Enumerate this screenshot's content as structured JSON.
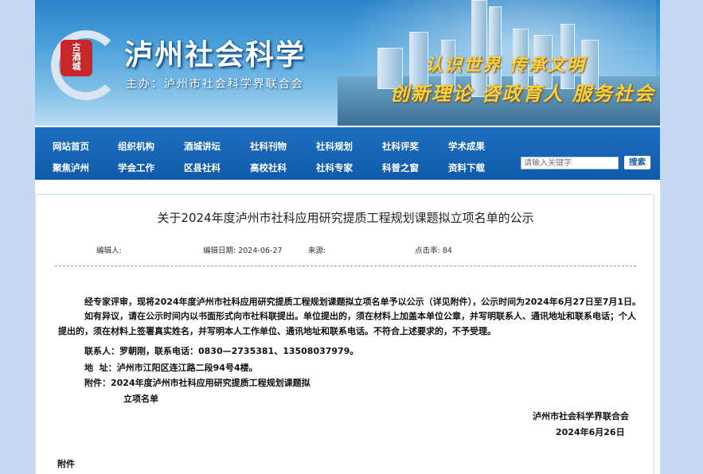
{
  "banner": {
    "title": "泸州社会科学",
    "subtitle": "主办：泸州市社会科学界联合会",
    "seal_text": "古\n酒\n城",
    "slogan_line1": "认识世界 传承文明",
    "slogan_line2": "创新理论 咨政育人 服务社会"
  },
  "nav": {
    "row1": [
      "网站首页",
      "组织机构",
      "酒城讲坛",
      "社科刊物",
      "社科规划",
      "社科评奖",
      "学术成果"
    ],
    "row2": [
      "聚焦泸州",
      "学会工作",
      "区县社科",
      "高校社科",
      "社科专家",
      "科普之窗",
      "资料下载"
    ],
    "search_placeholder": "请输入关键字",
    "search_button": "搜索"
  },
  "article": {
    "title": "关于2024年度泸州市社科应用研究提质工程规划课题拟立项名单的公示",
    "editor_label": "编辑人:",
    "date_label": "编辑日期: 2024-06-27",
    "source_label": "来源:",
    "clicks_label": "点击率: 84",
    "para1": "经专家评审，现将2024年度泸州市社科应用研究提质工程规划课题拟立项名单予以公示（详见附件），公示时间为2024年6月27日至7月1日。",
    "para2": "如有异议，请在公示时间内以书面形式向市社科联提出。单位提出的，须在材料上加盖本单位公章，并写明联系人、通讯地址和联系电话；个人提出的，须在材料上签署真实姓名，并写明本人工作单位、通讯地址和联系电话。不符合上述要求的，不予受理。",
    "contact": "联系人：罗朝刚，联系电话：0830—2735381、13508037979。",
    "address": "地  址：泸州市江阳区连江路二段94号4楼。",
    "attachment_line1": "附件：2024年度泸州市社科应用研究提质工程规划课题拟",
    "attachment_line2": "立项名单",
    "signer": "泸州市社会科学界联合会",
    "sign_date": "2024年6月26日",
    "attachment_heading": "附件"
  }
}
